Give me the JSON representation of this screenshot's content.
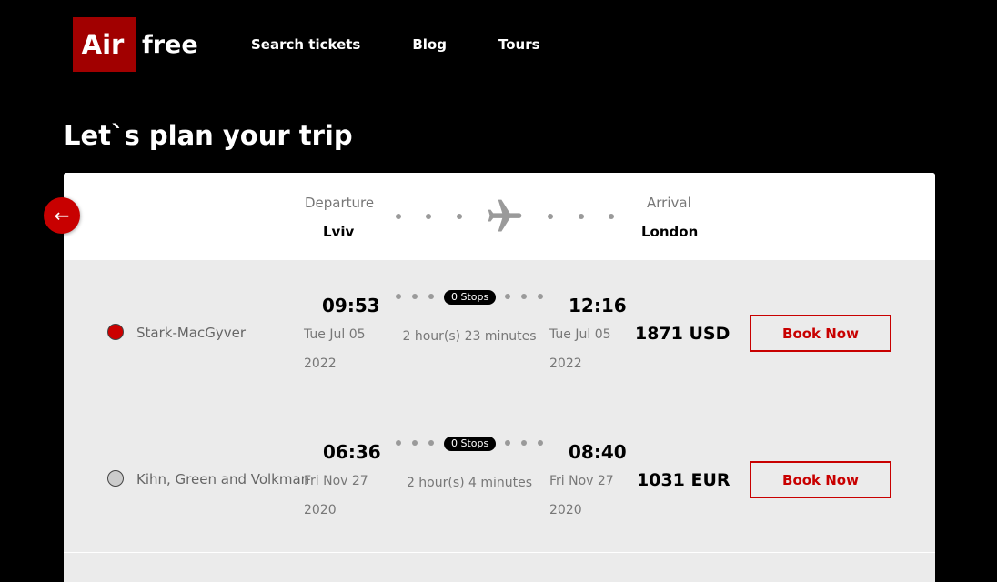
{
  "brand": {
    "logo_left": "Air",
    "logo_right": "free",
    "accent": "#a10000"
  },
  "nav": [
    "Search tickets",
    "Blog",
    "Tours"
  ],
  "page_title": "Let`s plan your trip",
  "back_button": {
    "icon": "arrow-left-icon",
    "glyph": "←"
  },
  "route": {
    "departure_label": "Departure",
    "departure_city": "Lviv",
    "arrival_label": "Arrival",
    "arrival_city": "London",
    "icon": "airplane-icon"
  },
  "flights": [
    {
      "airline": "Stark-MacGyver",
      "logo_color": "#cc0000",
      "depart_time": "09:53",
      "depart_date_1": "Tue Jul 05",
      "depart_date_2": "2022",
      "stops": "0 Stops",
      "duration": "2 hour(s) 23 minutes",
      "arrive_time": "12:16",
      "arrive_date_1": "Tue Jul 05",
      "arrive_date_2": "2022",
      "price": "1871 USD",
      "book_label": "Book Now"
    },
    {
      "airline": "Kihn, Green and Volkman",
      "logo_color": "#cccccc",
      "depart_time": "06:36",
      "depart_date_1": "Fri Nov 27",
      "depart_date_2": "2020",
      "stops": "0 Stops",
      "duration": "2 hour(s) 4 minutes",
      "arrive_time": "08:40",
      "arrive_date_1": "Fri Nov 27",
      "arrive_date_2": "2020",
      "price": "1031 EUR",
      "book_label": "Book Now"
    }
  ]
}
